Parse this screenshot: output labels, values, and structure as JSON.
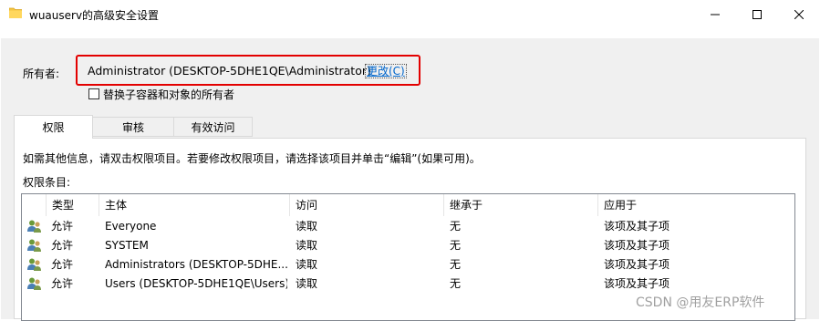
{
  "window": {
    "title": "wuauserv的高级安全设置",
    "icons": {
      "app": "folder-icon",
      "minimize": "minimize-icon",
      "maximize": "maximize-icon",
      "close": "close-icon"
    }
  },
  "owner": {
    "label": "所有者:",
    "value": "Administrator (DESKTOP-5DHE1QE\\Administrator)",
    "change_link": "更改(C)",
    "highlight_color": "#e30000"
  },
  "replace_owner": {
    "label": "替换子容器和对象的所有者",
    "checked": false
  },
  "tabs": [
    {
      "label": "权限",
      "active": true
    },
    {
      "label": "审核",
      "active": false
    },
    {
      "label": "有效访问",
      "active": false
    }
  ],
  "info_text": "如需其他信息，请双击权限项目。若要修改权限项目，请选择该项目并单击“编辑”(如果可用)。",
  "entries_label": "权限条目:",
  "table": {
    "columns": [
      "类型",
      "主体",
      "访问",
      "继承于",
      "应用于"
    ],
    "rows": [
      {
        "icon": "users-icon",
        "type": "允许",
        "principal": "Everyone",
        "access": "读取",
        "inherited_from": "无",
        "applies_to": "该项及其子项"
      },
      {
        "icon": "users-icon",
        "type": "允许",
        "principal": "SYSTEM",
        "access": "读取",
        "inherited_from": "无",
        "applies_to": "该项及其子项"
      },
      {
        "icon": "users-icon",
        "type": "允许",
        "principal": "Administrators (DESKTOP-5DHE...",
        "access": "读取",
        "inherited_from": "无",
        "applies_to": "该项及其子项"
      },
      {
        "icon": "users-icon",
        "type": "允许",
        "principal": "Users (DESKTOP-5DHE1QE\\Users)",
        "access": "读取",
        "inherited_from": "无",
        "applies_to": "该项及其子项"
      }
    ]
  },
  "watermark": "CSDN @用友ERP软件"
}
